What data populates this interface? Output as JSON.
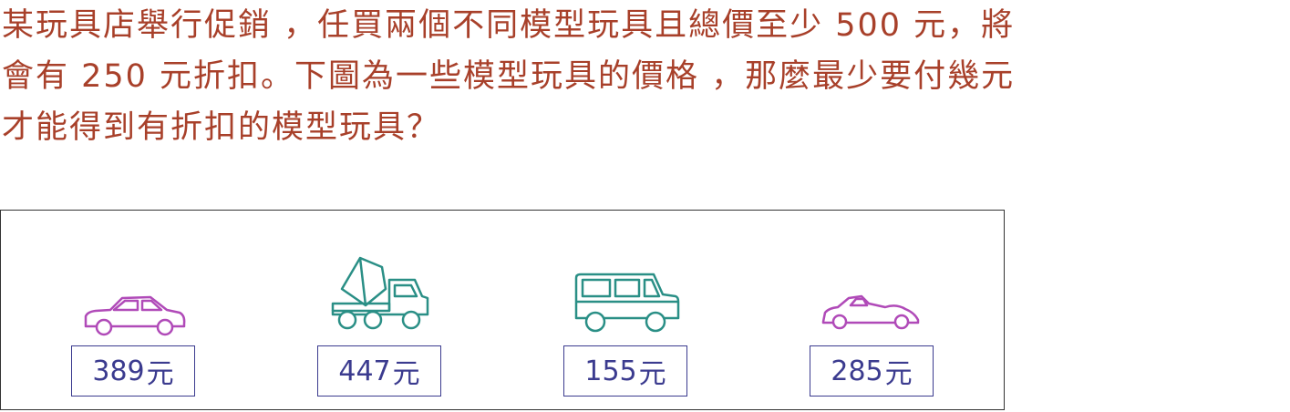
{
  "question": {
    "line1": "某玩具店舉行促銷 ，任買兩個不同模型玩具且總價至少 500 元，將",
    "line2": "會有 250 元折扣。下圖為一些模型玩具的價格 ，那麼最少要付幾元",
    "line3": "才能得到有折扣的模型玩具？"
  },
  "items": [
    {
      "icon": "sedan-car-icon",
      "color": "#b04ab8",
      "price": "389",
      "unit": "元"
    },
    {
      "icon": "cement-mixer-truck-icon",
      "color": "#2a8f86",
      "price": "447",
      "unit": "元"
    },
    {
      "icon": "jeep-icon",
      "color": "#2a8f86",
      "price": "155",
      "unit": "元"
    },
    {
      "icon": "sports-car-icon",
      "color": "#b04ab8",
      "price": "285",
      "unit": "元"
    }
  ]
}
